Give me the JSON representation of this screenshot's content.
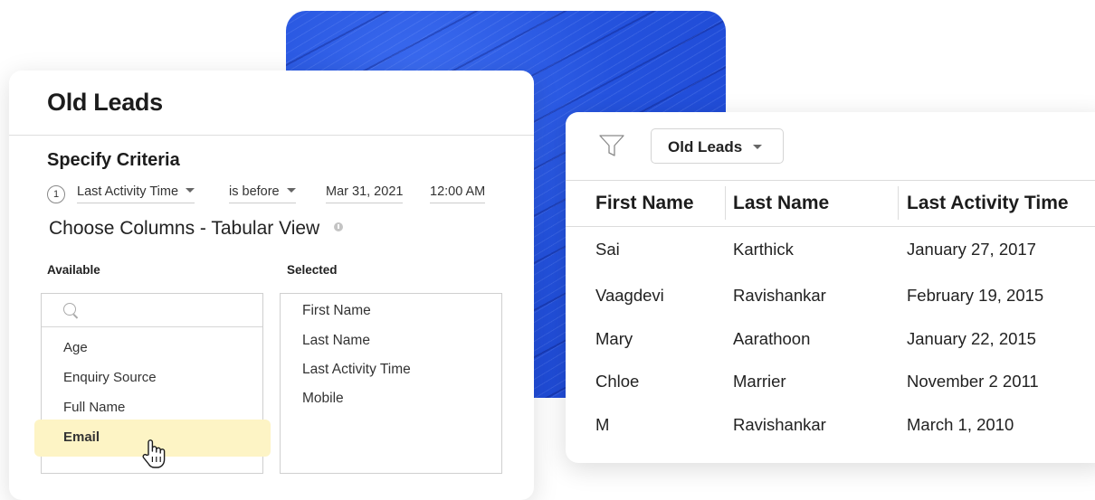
{
  "left_panel": {
    "title": "Old Leads",
    "criteria_title": "Specify Criteria",
    "criterion": {
      "number": "1",
      "field": "Last Activity Time",
      "operator": "is before",
      "date": "Mar 31, 2021",
      "time": "12:00 AM"
    },
    "choose_columns_title": "Choose Columns - Tabular View",
    "available_label": "Available",
    "selected_label": "Selected",
    "available_items": [
      "Age",
      "Enquiry Source",
      "Full Name"
    ],
    "highlighted_item": "Email",
    "selected_items": [
      "First Name",
      "Last Name",
      "Last Activity Time",
      "Mobile"
    ]
  },
  "right_panel": {
    "view_name": "Old Leads",
    "columns": [
      "First Name",
      "Last Name",
      "Last Activity Time"
    ],
    "rows": [
      [
        "Sai",
        "Karthick",
        "January 27, 2017"
      ],
      [
        "Vaagdevi",
        "Ravishankar",
        "February 19, 2015"
      ],
      [
        "Mary",
        "Aarathoon",
        "January 22, 2015"
      ],
      [
        "Chloe",
        "Marrier",
        "November 2 2011"
      ],
      [
        "M",
        "Ravishankar",
        "March 1, 2010"
      ]
    ]
  },
  "colors": {
    "backdrop_blue": "#2452dd",
    "highlight_yellow": "#fdf4c5"
  },
  "icons": [
    "search-icon",
    "info-icon",
    "hand-pointer-icon",
    "filter-icon",
    "chevron-down-icon"
  ]
}
